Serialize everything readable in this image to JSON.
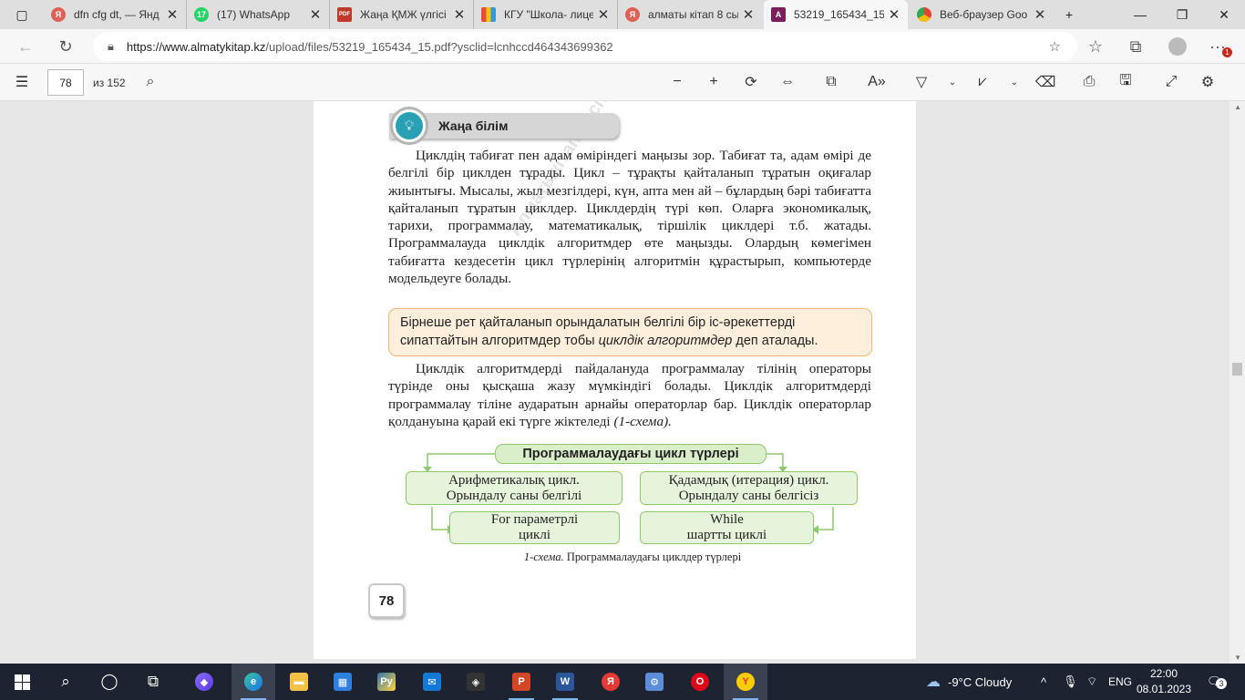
{
  "browser": {
    "tabs": [
      {
        "icon": "yandex-icon",
        "color": "#d9534f",
        "letter": "Я",
        "label": "dfn cfg dt, — Янд"
      },
      {
        "icon": "whatsapp-icon",
        "color": "#25d366",
        "letter": "17",
        "label": "(17) WhatsApp"
      },
      {
        "icon": "pdf-icon",
        "color": "#c0392b",
        "letter": "PDF",
        "label": "Жаңа ҚМЖ үлгісі"
      },
      {
        "icon": "site-icon",
        "color": "#8e44ad",
        "letter": "|||",
        "label": "КГУ \"Школа- лице"
      },
      {
        "icon": "yandex-icon",
        "color": "#d9534f",
        "letter": "Я",
        "label": "алматы кітап 8 сы"
      },
      {
        "icon": "acrobat-icon",
        "color": "#7a1f5c",
        "letter": "A",
        "label": "53219_165434_15"
      },
      {
        "icon": "chrome-icon",
        "color": "#34a853",
        "letter": "G",
        "label": "Веб-браузер Goo"
      }
    ],
    "active_tab": 5,
    "url_host": "https://www.almatykitap.kz",
    "url_path": "/upload/files/53219_165434_15.pdf?ysclid=lcnhccd464343699362",
    "notification_count": "1"
  },
  "pdf_toolbar": {
    "page_number": "78",
    "total_pages": "из 152"
  },
  "page": {
    "section_title": "Жаңа білім",
    "para1": "Циклдің табиғат пен адам өміріндегі маңызы зор. Табиғат та, адам өмірі де белгілі бір циклден тұрады. Цикл – тұрақты қайталанып тұратын оқиғалар жиынтығы. Мысалы, жыл мезгілдері, күн, апта мен ай – бұлардың бәрі табиғатта қайталанып тұратын циклдер. Циклдердің түрі көп. Оларға экономикалық, тарихи, программалау, математикалық, тіршілік циклдері т.б. жатады. Программалауда циклдік алгоритмдер өте маңызды. Олардың көмегімен табиғатта кездесетін цикл түрлерінің алгоритмін құрастырып, компьютерде модельдеуге болады.",
    "definition_text": "Бірнеше рет қайталанып орындалатын белгілі бір іс-әрекеттерді сипаттайтын алгоритмдер тобы",
    "definition_term": "циклдік алгоритмдер",
    "definition_tail": "деп аталады.",
    "para2": "Циклдік алгоритмдерді пайдалануда программалау тілінің операторы түрінде оны қысқаша жазу мүмкіндігі болады. Циклдік алгоритмдерді программалау тіліне аударатын арнайы операторлар бар. Циклдік операторлар қолдануына қарай екі түрге жіктеледі",
    "para2_ref": "(1-схема).",
    "scheme": {
      "root": "Программалаудағы цикл түрлері",
      "left1": "Арифметикалық цикл.",
      "left2": "Орындалу саны белгілі",
      "right1": "Қадамдық (итерация) цикл.",
      "right2": "Орындалу саны белгісіз",
      "leftchild1": "For параметрлі",
      "leftchild2": "циклі",
      "rightchild1": "While",
      "rightchild2": "шартты циклі"
    },
    "caption_label": "1-схема.",
    "caption_text": "Программалаудағы циклдер түрлері",
    "page_number": "78",
    "watermark": "Алматыкітап баспасы"
  },
  "taskbar": {
    "weather": "-9°C  Cloudy",
    "lang": "ENG",
    "time": "22:00",
    "date": "08.01.2023",
    "notif": "3"
  }
}
